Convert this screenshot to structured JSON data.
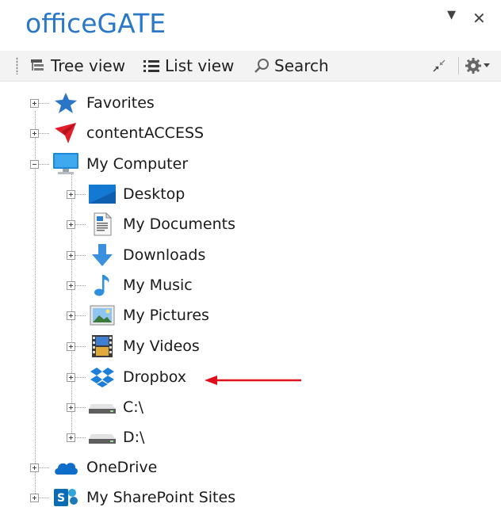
{
  "window": {
    "title": "officeGATE",
    "dropdown_glyph": "▾",
    "close_glyph": "✕"
  },
  "toolbar": {
    "tree_view_label": "Tree view",
    "list_view_label": "List view",
    "search_label": "Search",
    "icons": [
      "tree-view-icon",
      "list-view-icon",
      "search-icon",
      "collapse-icon",
      "gear-icon",
      "chevron-down-icon"
    ]
  },
  "tree": {
    "favorites": "Favorites",
    "content_access": "contentACCESS",
    "my_computer": "My Computer",
    "children": {
      "desktop": "Desktop",
      "my_documents": "My Documents",
      "downloads": "Downloads",
      "my_music": "My Music",
      "my_pictures": "My Pictures",
      "my_videos": "My Videos",
      "dropbox": "Dropbox",
      "c_drive": "C:\\",
      "d_drive": "D:\\"
    },
    "onedrive": "OneDrive",
    "sharepoint": "My SharePoint Sites"
  },
  "colors": {
    "title_blue": "#2b78c8",
    "annotation_arrow": "#e0101a"
  }
}
